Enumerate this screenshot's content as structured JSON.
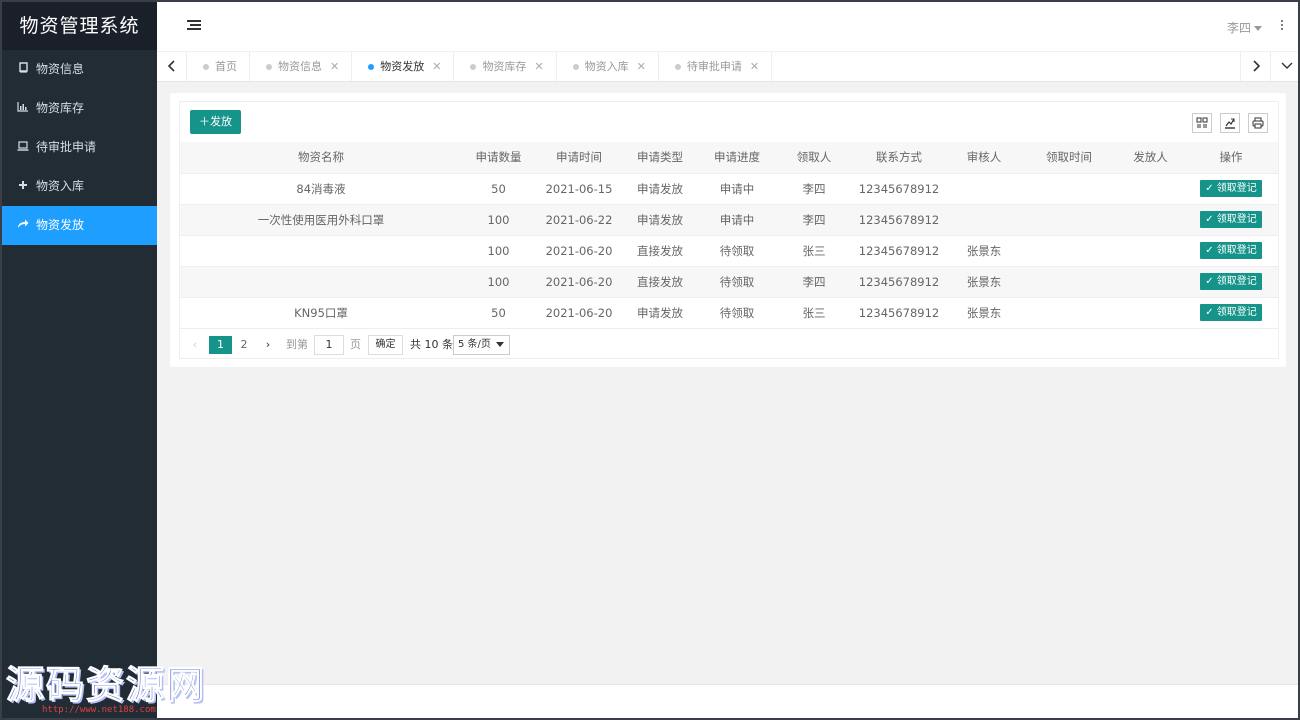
{
  "app": {
    "title": "物资管理系统"
  },
  "sidebar": {
    "items": [
      {
        "label": "物资信息",
        "icon": "book-icon",
        "active": false
      },
      {
        "label": "物资库存",
        "icon": "bar-chart-icon",
        "active": false
      },
      {
        "label": "待审批申请",
        "icon": "laptop-icon",
        "active": false
      },
      {
        "label": "物资入库",
        "icon": "plus-icon",
        "active": false
      },
      {
        "label": "物资发放",
        "icon": "share-icon",
        "active": true
      }
    ]
  },
  "header": {
    "user": "李四"
  },
  "tabs": [
    {
      "label": "首页",
      "closable": false,
      "active": false
    },
    {
      "label": "物资信息",
      "closable": true,
      "active": false
    },
    {
      "label": "物资发放",
      "closable": true,
      "active": true
    },
    {
      "label": "物资库存",
      "closable": true,
      "active": false
    },
    {
      "label": "物资入库",
      "closable": true,
      "active": false
    },
    {
      "label": "待审批申请",
      "closable": true,
      "active": false
    }
  ],
  "toolbar": {
    "add_label": "发放"
  },
  "table": {
    "columns": [
      "物资名称",
      "申请数量",
      "申请时间",
      "申请类型",
      "申请进度",
      "领取人",
      "联系方式",
      "审核人",
      "领取时间",
      "发放人",
      "操作"
    ],
    "rows": [
      [
        "84消毒液",
        "50",
        "2021-06-15",
        "申请发放",
        "申请中",
        "李四",
        "12345678912",
        "",
        "",
        ""
      ],
      [
        "一次性使用医用外科口罩",
        "100",
        "2021-06-22",
        "申请发放",
        "申请中",
        "李四",
        "12345678912",
        "",
        "",
        ""
      ],
      [
        "",
        "100",
        "2021-06-20",
        "直接发放",
        "待领取",
        "张三",
        "12345678912",
        "张景东",
        "",
        ""
      ],
      [
        "",
        "100",
        "2021-06-20",
        "直接发放",
        "待领取",
        "李四",
        "12345678912",
        "张景东",
        "",
        ""
      ],
      [
        "KN95口罩",
        "50",
        "2021-06-20",
        "申请发放",
        "待领取",
        "张三",
        "12345678912",
        "张景东",
        "",
        ""
      ]
    ],
    "action_label": "领取登记"
  },
  "pager": {
    "pages": [
      "1",
      "2"
    ],
    "current": "1",
    "goto_label": "到第",
    "goto_value": "1",
    "page_unit": "页",
    "confirm": "确定",
    "total": "共 10 条",
    "page_size": "5 条/页"
  },
  "watermark": {
    "text": "源码资源网",
    "url": "http://www.net188.com"
  },
  "colors": {
    "sidebar": "#222c35",
    "active": "#1e9fff",
    "primary": "#16948a"
  }
}
